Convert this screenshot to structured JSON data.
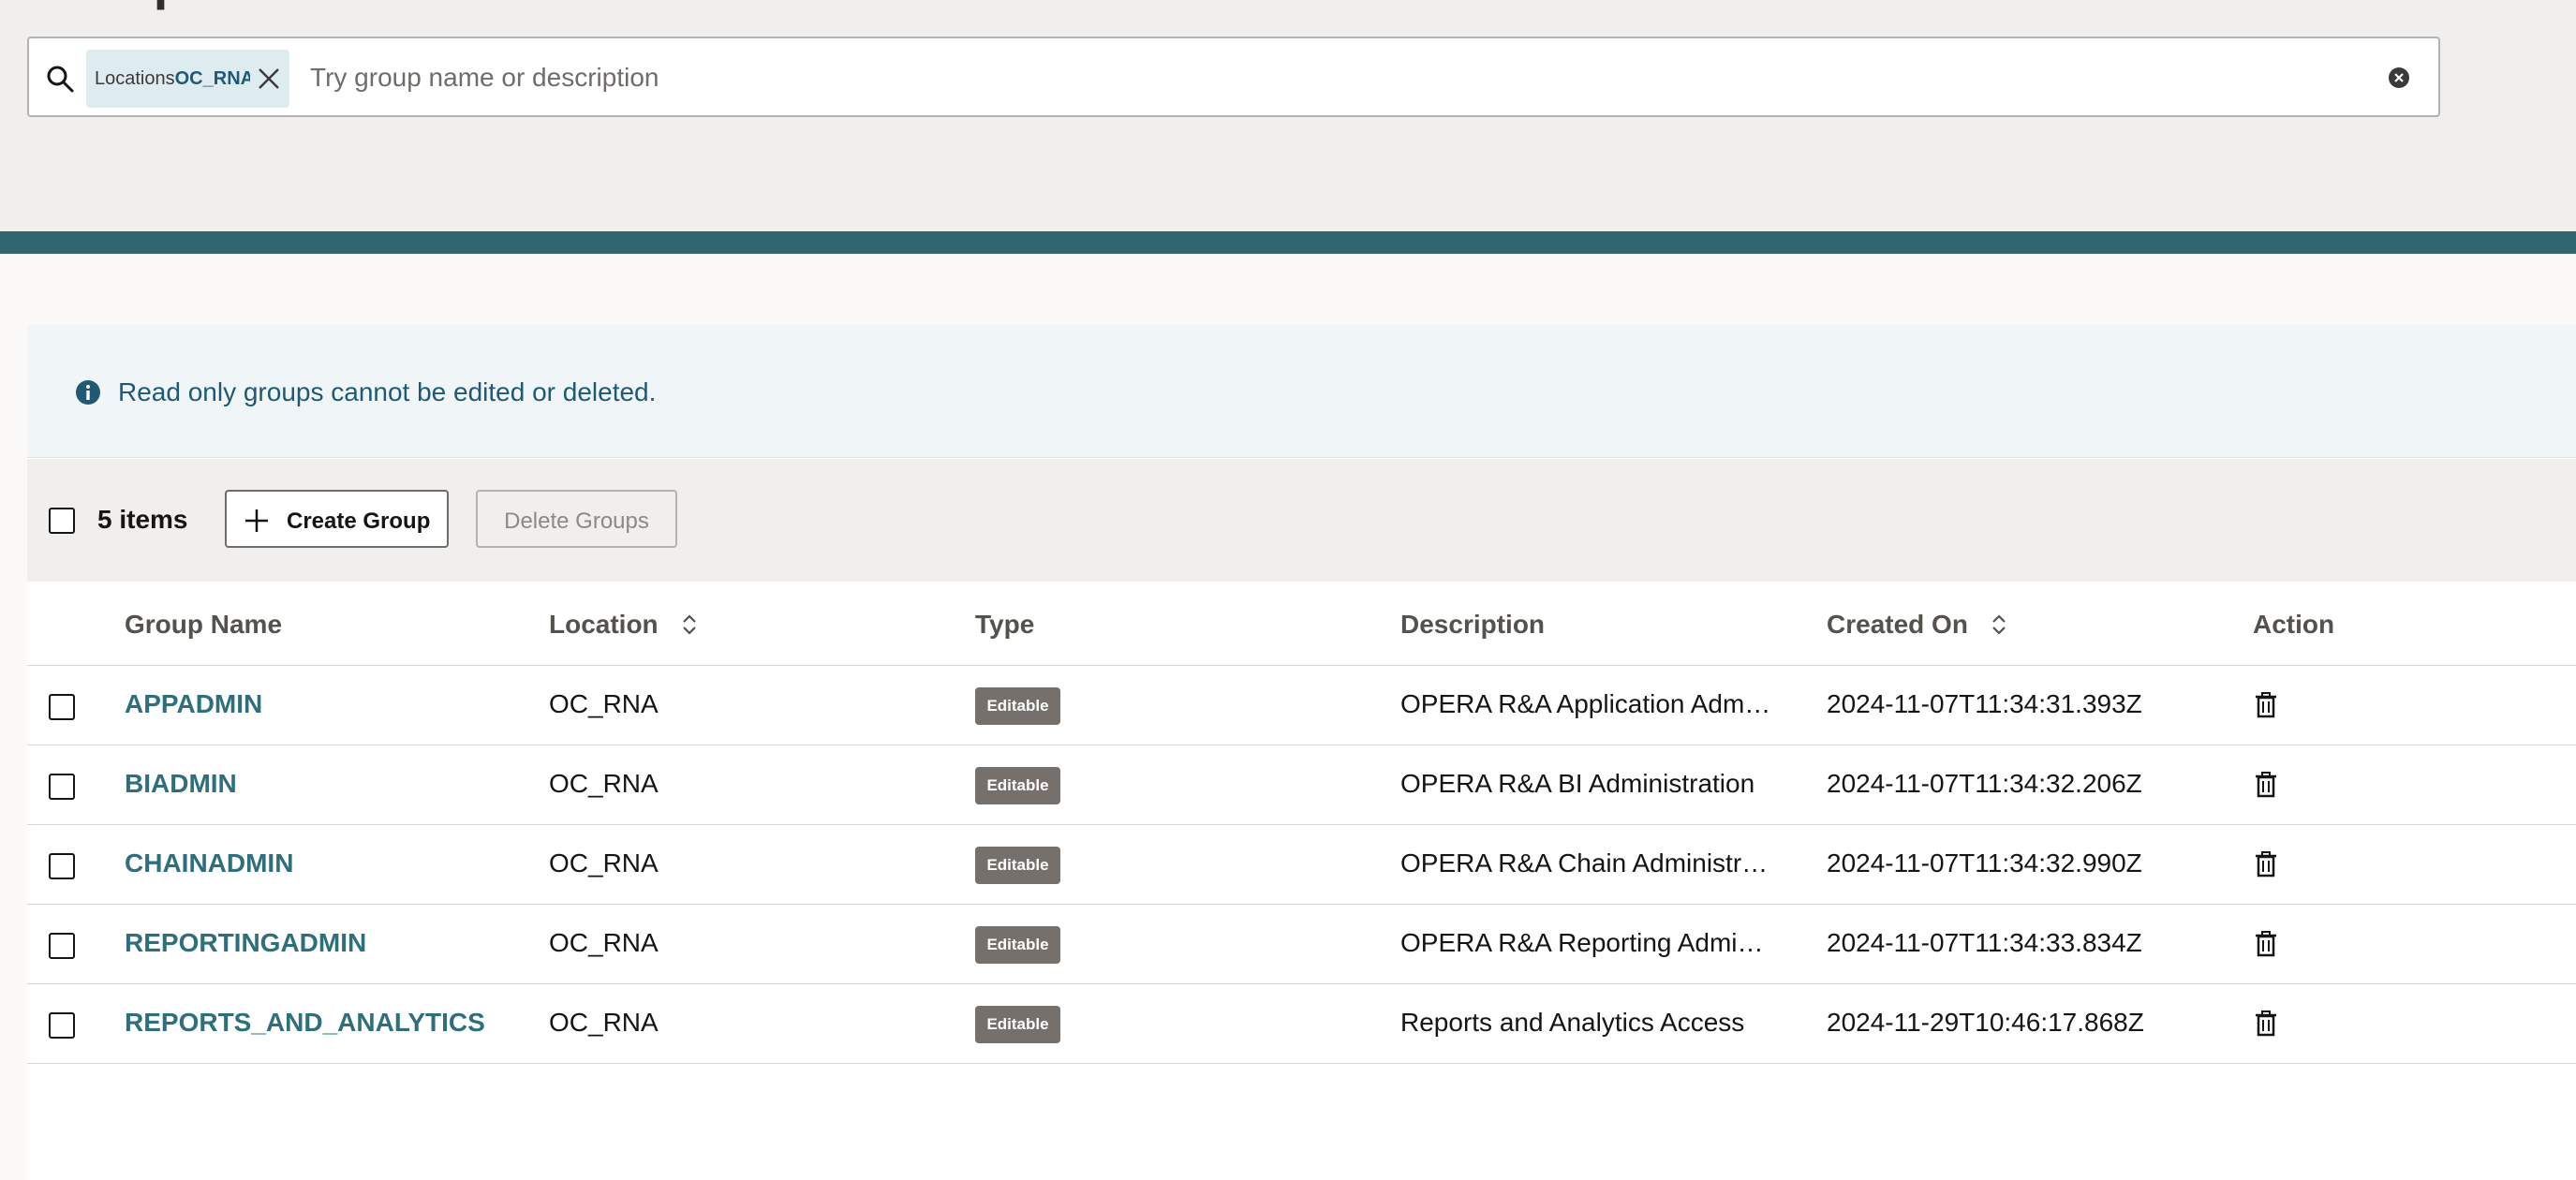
{
  "page": {
    "title": "Groups"
  },
  "search": {
    "chip_label": "Locations",
    "chip_value": "OC_RNA",
    "placeholder": "Try group name or description",
    "value": ""
  },
  "banner": {
    "text": "Read only groups cannot be edited or deleted."
  },
  "toolbar": {
    "item_count": "5 items",
    "create_label": "Create Group",
    "delete_label": "Delete Groups"
  },
  "table": {
    "headers": {
      "name": "Group Name",
      "location": "Location",
      "type": "Type",
      "description": "Description",
      "created": "Created On",
      "action": "Action"
    },
    "rows": [
      {
        "name": "APPADMIN",
        "location": "OC_RNA",
        "type": "Editable",
        "description": "OPERA R&A Application Adm…",
        "created": "2024-11-07T11:34:31.393Z"
      },
      {
        "name": "BIADMIN",
        "location": "OC_RNA",
        "type": "Editable",
        "description": "OPERA R&A BI Administration",
        "created": "2024-11-07T11:34:32.206Z"
      },
      {
        "name": "CHAINADMIN",
        "location": "OC_RNA",
        "type": "Editable",
        "description": "OPERA R&A Chain Administr…",
        "created": "2024-11-07T11:34:32.990Z"
      },
      {
        "name": "REPORTINGADMIN",
        "location": "OC_RNA",
        "type": "Editable",
        "description": "OPERA R&A Reporting Admi…",
        "created": "2024-11-07T11:34:33.834Z"
      },
      {
        "name": "REPORTS_AND_ANALYTICS",
        "location": "OC_RNA",
        "type": "Editable",
        "description": "Reports and Analytics Access",
        "created": "2024-11-29T10:46:17.868Z"
      }
    ]
  },
  "icons": {
    "search": "search-icon",
    "chip_close": "close-icon",
    "clear": "clear-icon",
    "info": "info-icon",
    "create": "plus-icon",
    "sort": "sort-icon",
    "delete": "trash-icon"
  },
  "colors": {
    "accent_teal": "#32666f",
    "link": "#2d6f7c",
    "banner_text": "#1f5974",
    "badge_bg": "#75706b"
  }
}
